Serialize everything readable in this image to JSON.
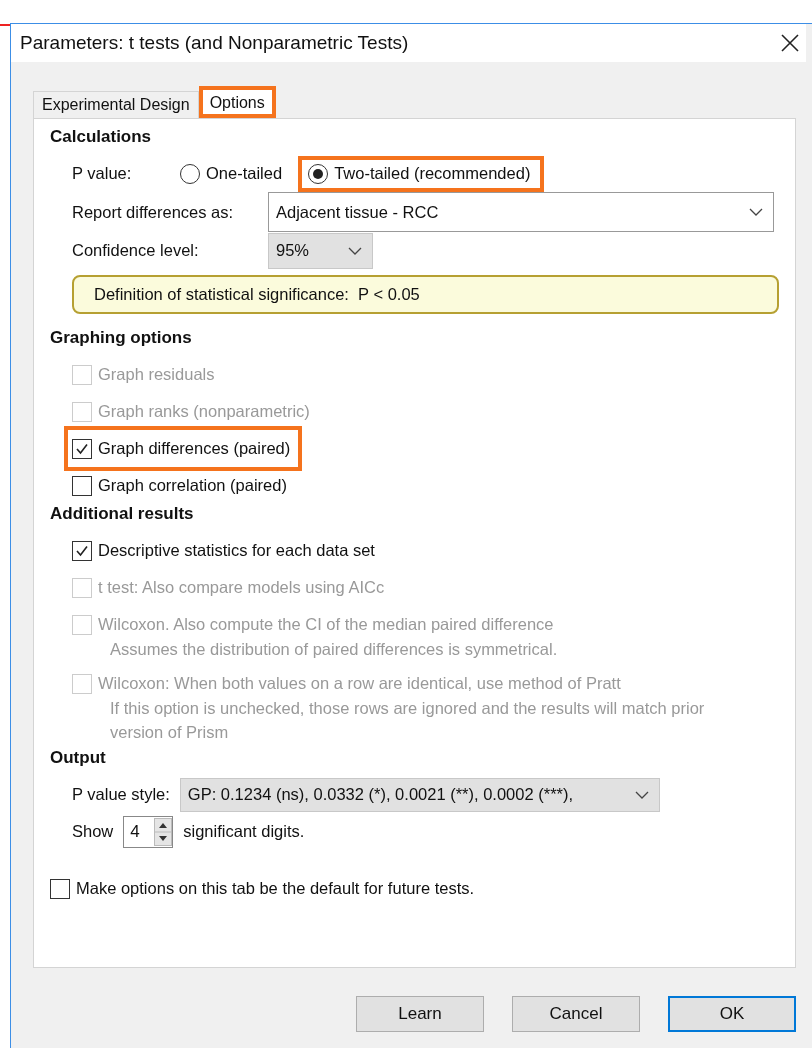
{
  "window": {
    "title": "Parameters: t tests (and Nonparametric Tests)"
  },
  "tabs": [
    {
      "label": "Experimental Design",
      "selected": false,
      "highlighted": false
    },
    {
      "label": "Options",
      "selected": true,
      "highlighted": true
    }
  ],
  "calculations": {
    "heading": "Calculations",
    "p_value": {
      "label": "P value:",
      "options": [
        {
          "label": "One-tailed",
          "selected": false,
          "highlighted": false
        },
        {
          "label": "Two-tailed (recommended)",
          "selected": true,
          "highlighted": true
        }
      ]
    },
    "report_differences": {
      "label": "Report differences as:",
      "value": "Adjacent tissue - RCC"
    },
    "confidence": {
      "label": "Confidence level:",
      "value": "95%"
    },
    "significance_note": "Definition of statistical significance:  P < 0.05"
  },
  "graphing_options": {
    "heading": "Graphing options",
    "items": [
      {
        "label": "Graph residuals",
        "checked": false,
        "disabled": true,
        "highlighted": false
      },
      {
        "label": "Graph ranks (nonparametric)",
        "checked": false,
        "disabled": true,
        "highlighted": false
      },
      {
        "label": "Graph differences (paired)",
        "checked": true,
        "disabled": false,
        "highlighted": true
      },
      {
        "label": "Graph correlation (paired)",
        "checked": false,
        "disabled": false,
        "highlighted": false
      }
    ]
  },
  "additional_results": {
    "heading": "Additional results",
    "items": [
      {
        "label": "Descriptive statistics for each data set",
        "checked": true,
        "disabled": false
      },
      {
        "label": "t test: Also compare models using AICc",
        "checked": false,
        "disabled": true
      },
      {
        "label": "Wilcoxon. Also compute the CI of the median paired difference",
        "checked": false,
        "disabled": true,
        "note": "Assumes the distribution of paired differences is symmetrical."
      },
      {
        "label": "Wilcoxon: When both values on a row are identical, use method of Pratt",
        "checked": false,
        "disabled": true,
        "note": "If this option is unchecked, those rows are ignored and the results will match prior version of Prism"
      }
    ]
  },
  "output": {
    "heading": "Output",
    "p_value_style": {
      "label": "P value style:",
      "value": "GP: 0.1234 (ns), 0.0332 (*), 0.0021 (**), 0.0002 (***),"
    },
    "show_label": "Show",
    "digits": "4",
    "digits_suffix": "significant digits."
  },
  "default_option": {
    "label": "Make options on this tab be the default for future tests.",
    "checked": false
  },
  "buttons": [
    {
      "label": "Learn",
      "default": false
    },
    {
      "label": "Cancel",
      "default": false
    },
    {
      "label": "OK",
      "default": true
    }
  ]
}
